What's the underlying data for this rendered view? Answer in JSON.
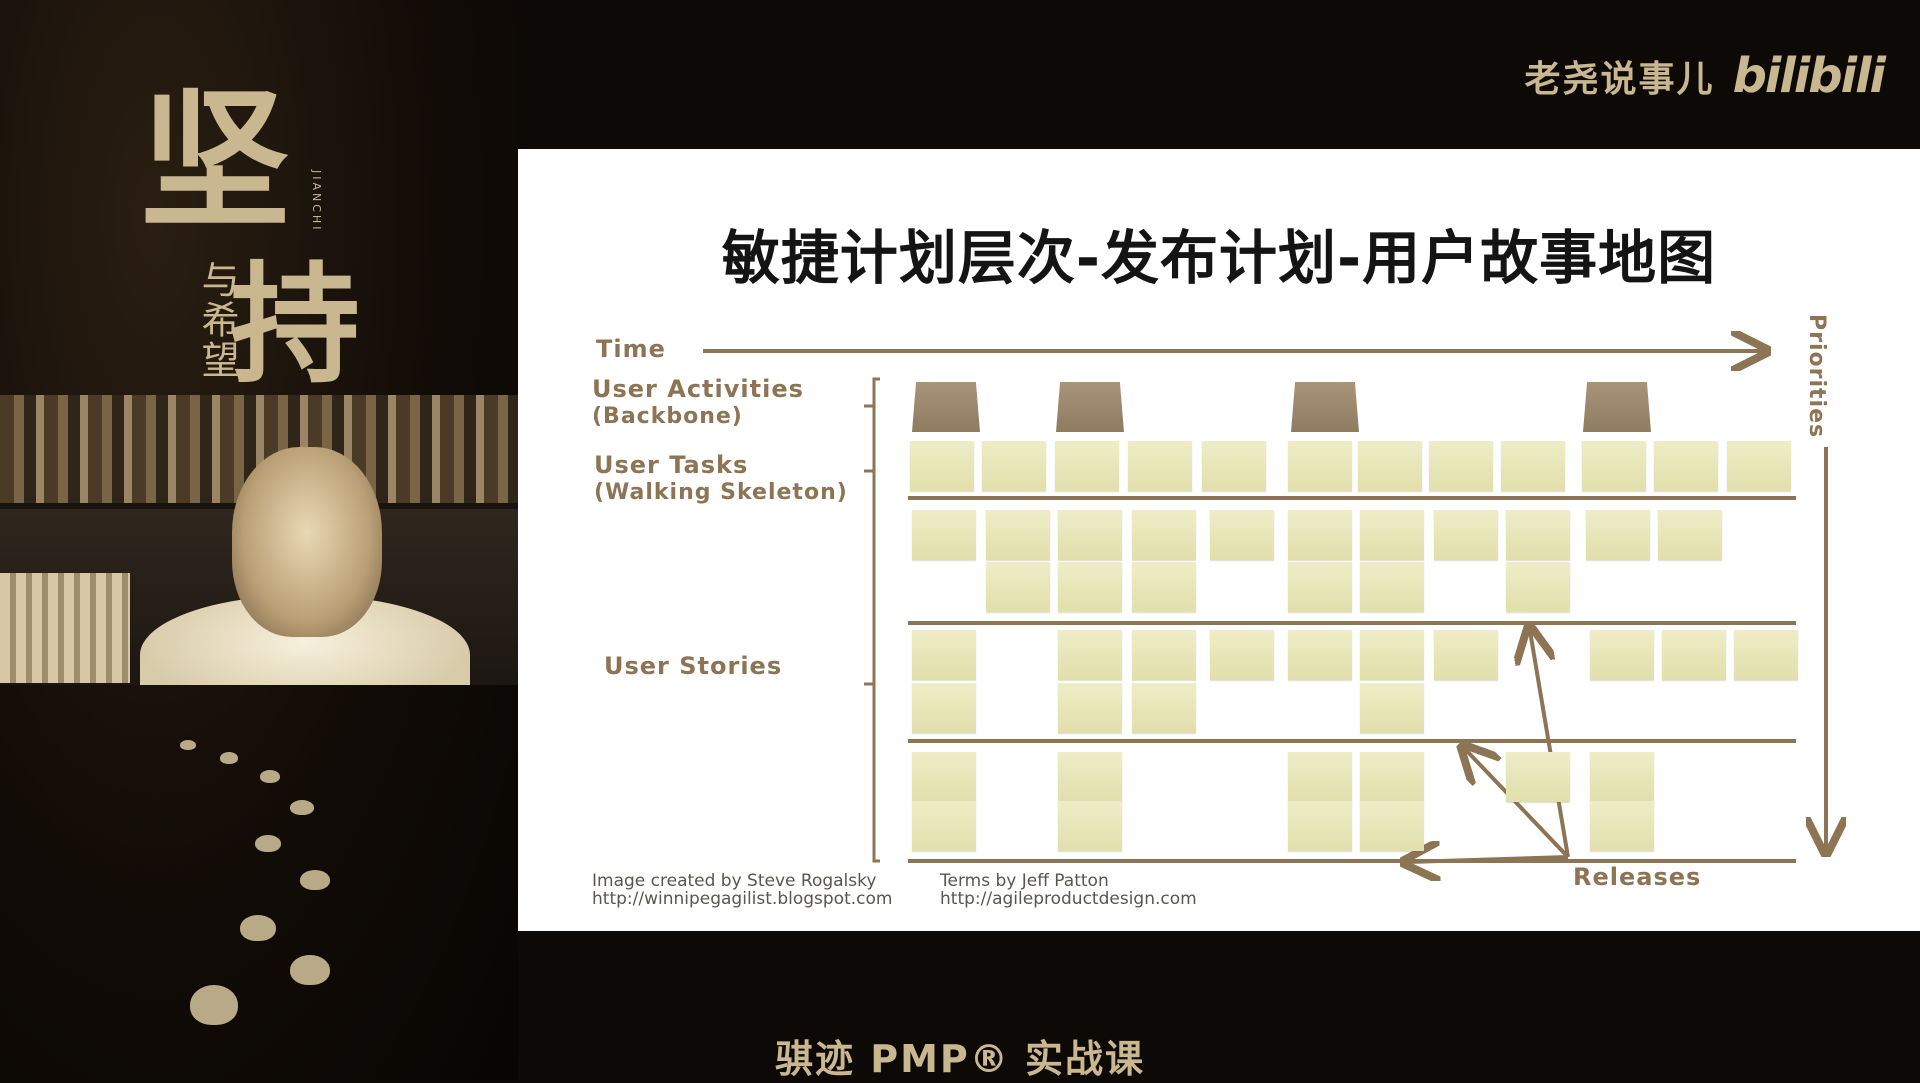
{
  "left_panel": {
    "calligraphy_main_1": "坚",
    "calligraphy_main_2": "持",
    "calligraphy_small": "与希望",
    "calligraphy_roman": "JIANCHI"
  },
  "logo": {
    "author": "老尧说事儿",
    "brand": "bilibili"
  },
  "slide": {
    "title": "敏捷计划层次-发布计划-用户故事地图",
    "time_label": "Time",
    "priorities_label": "Priorities",
    "rows": {
      "activities_line1": "User Activities",
      "activities_line2": "(Backbone)",
      "tasks_line1": "User Tasks",
      "tasks_line2": "(Walking Skeleton)",
      "stories": "User Stories"
    },
    "releases_label": "Releases",
    "credit_left_line1": "Image created by Steve Rogalsky",
    "credit_left_line2": "http://winnipegagilist.blogspot.com",
    "credit_right_line1": "Terms by Jeff Patton",
    "credit_right_line2": "http://agileproductdesign.com",
    "colors": {
      "label_brown": "#8c7454",
      "sticky_yellow": "#e6e4b2",
      "activity_brown": "#9a8669"
    }
  },
  "caption": "骐迹 PMP® 实战课"
}
